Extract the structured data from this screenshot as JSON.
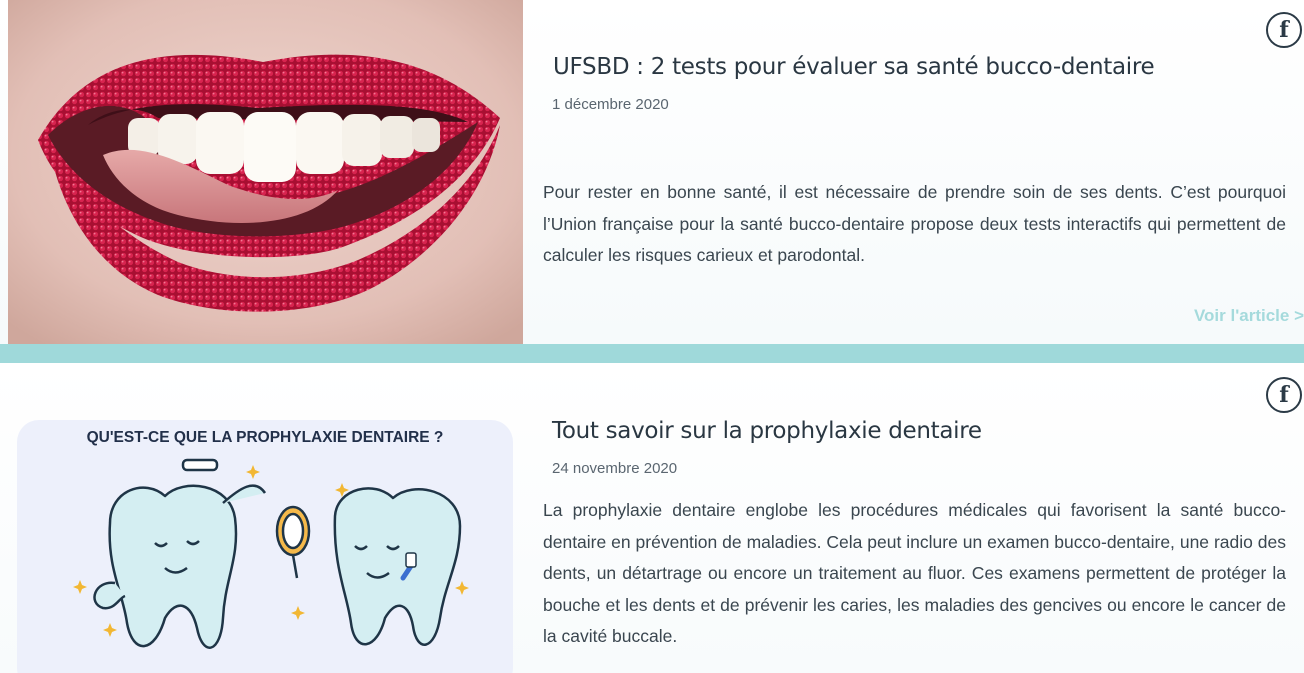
{
  "articles": [
    {
      "title": "UFSBD : 2 tests pour évaluer sa santé bucco-dentaire",
      "date": "1 décembre 2020",
      "excerpt": "Pour rester en bonne santé, il est nécessaire de prendre soin de ses dents. C’est pourquoi l’Union française pour la santé bucco-dentaire propose deux tests interactifs qui permettent de calculer les risques carieux et parodontal.",
      "link_label": "Voir l'article >",
      "share_icon": "facebook-icon",
      "share_glyph": "f",
      "image": "photo of smiling mouth with red sugar-coated lips"
    },
    {
      "title": "Tout savoir sur la prophylaxie dentaire",
      "date": "24 novembre 2020",
      "excerpt": "La prophylaxie dentaire englobe les procédures médicales qui favorisent la santé bucco-dentaire en prévention de maladies. Cela peut inclure un examen bucco-dentaire, une radio des dents, un détartrage ou encore un traitement au fluor. Ces examens permettent de protéger la bouche et les dents et de prévenir les caries, les maladies des gencives ou encore le cancer de la cavité buccale.",
      "share_icon": "facebook-icon",
      "share_glyph": "f",
      "image_heading": "QU'EST-CE QUE LA PROPHYLAXIE DENTAIRE ?"
    }
  ],
  "colors": {
    "divider": "#9fd9da",
    "link": "#a5dadc",
    "title": "#2a3742",
    "lip_red": "#c0153a"
  }
}
